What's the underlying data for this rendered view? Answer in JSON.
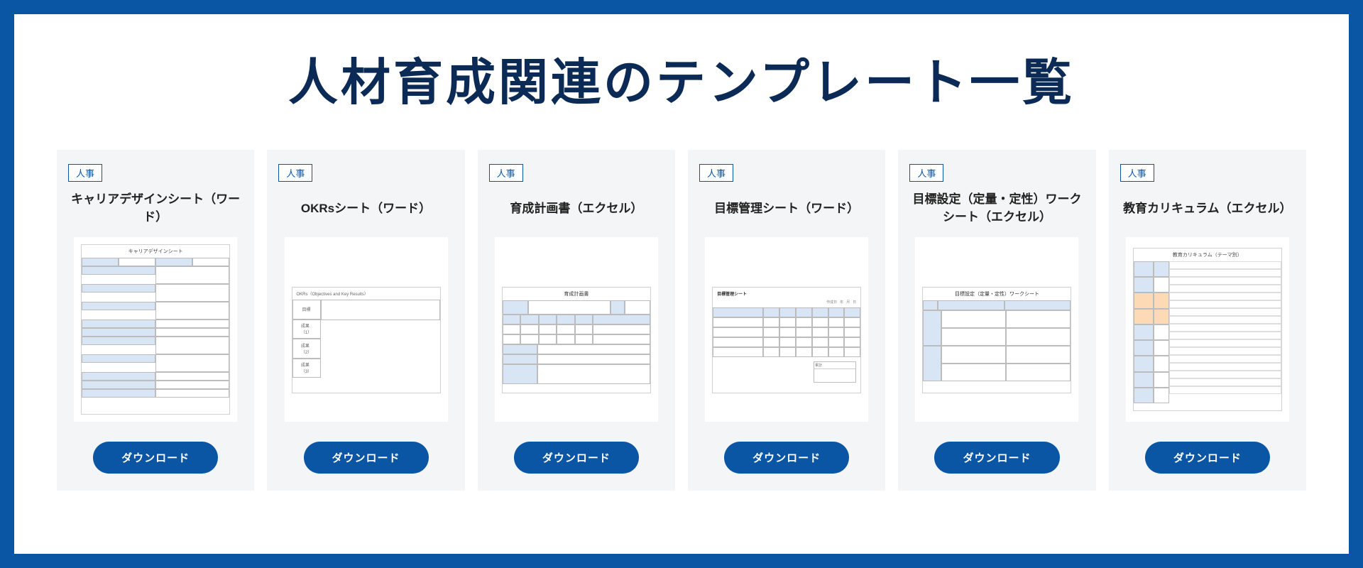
{
  "page_title": "人材育成関連のテンプレート一覧",
  "download_label": "ダウンロード",
  "cards": [
    {
      "tag": "人事",
      "title": "キャリアデザインシート（ワード）"
    },
    {
      "tag": "人事",
      "title": "OKRsシート（ワード）"
    },
    {
      "tag": "人事",
      "title": "育成計画書（エクセル）"
    },
    {
      "tag": "人事",
      "title": "目標管理シート（ワード）"
    },
    {
      "tag": "人事",
      "title": "目標設定（定量・定性）ワークシート（エクセル）"
    },
    {
      "tag": "人事",
      "title": "教育カリキュラム（エクセル）"
    }
  ]
}
